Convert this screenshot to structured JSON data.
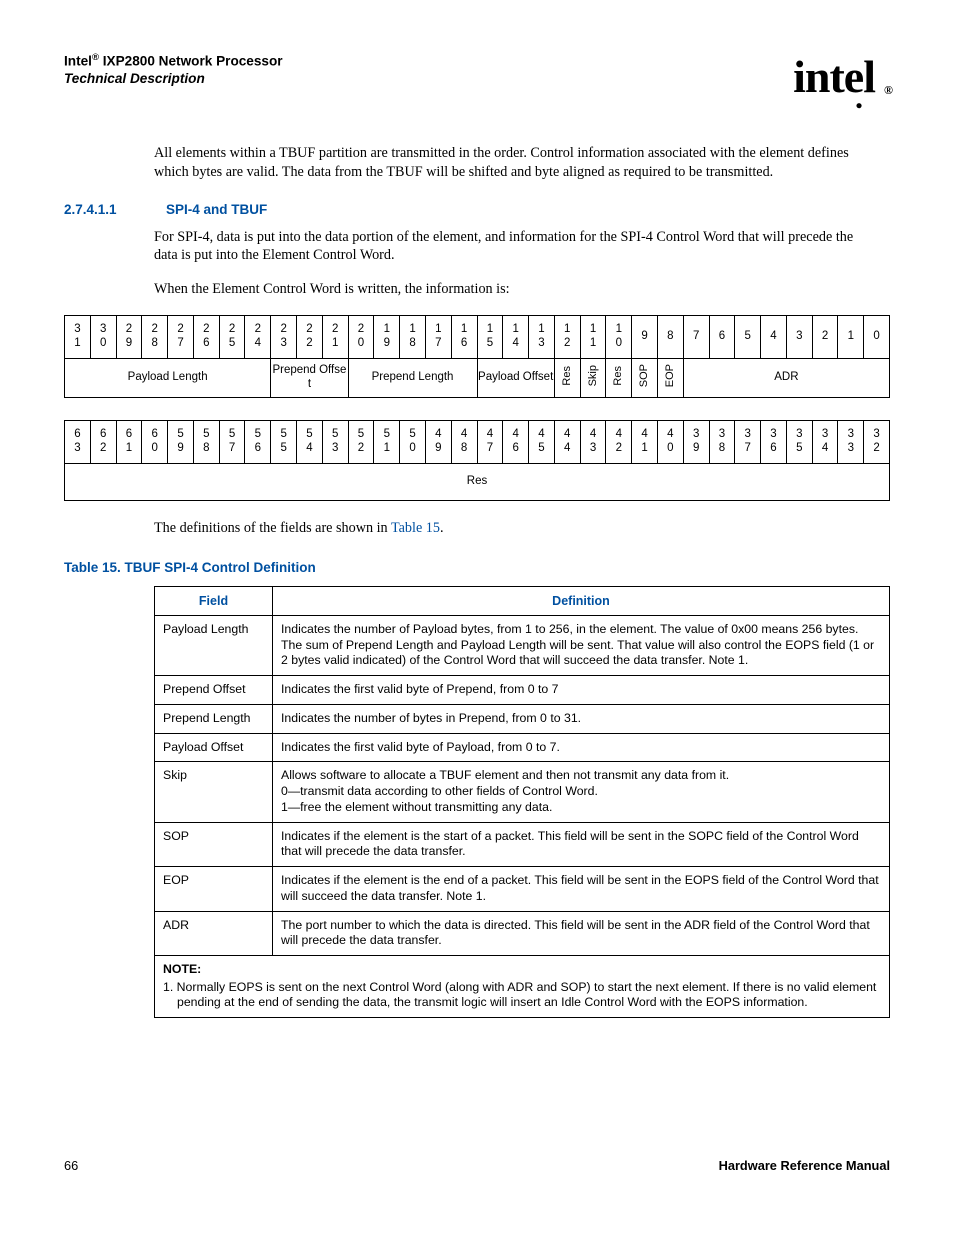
{
  "header": {
    "line1_a": "Intel",
    "line1_sup": "®",
    "line1_b": " IXP2800 Network Processor",
    "line2": "Technical Description",
    "logo_text": "intel",
    "logo_reg": "®"
  },
  "intro_para": "All elements within a TBUF partition are transmitted in the order. Control information associated with the element defines which bytes are valid. The data from the TBUF will be shifted and byte aligned as required to be transmitted.",
  "section": {
    "num": "2.7.4.1.1",
    "title": "SPI-4 and TBUF",
    "p1": "For SPI-4, data is put into the data portion of the element, and information for the SPI-4 Control Word that will precede the data is put into the Element Control Word.",
    "p2": "When the Element Control Word is written, the information is:"
  },
  "bits_t1": {
    "headers": [
      "3\n1",
      "3\n0",
      "2\n9",
      "2\n8",
      "2\n7",
      "2\n6",
      "2\n5",
      "2\n4",
      "2\n3",
      "2\n2",
      "2\n1",
      "2\n0",
      "1\n9",
      "1\n8",
      "1\n7",
      "1\n6",
      "1\n5",
      "1\n4",
      "1\n3",
      "1\n2",
      "1\n1",
      "1\n0",
      "9",
      "8",
      "7",
      "6",
      "5",
      "4",
      "3",
      "2",
      "1",
      "0"
    ],
    "row": [
      {
        "span": 8,
        "label": "Payload Length",
        "vert": false
      },
      {
        "span": 3,
        "label": "Prepend Offset",
        "vert": false
      },
      {
        "span": 5,
        "label": "Prepend Length",
        "vert": false
      },
      {
        "span": 3,
        "label": "Payload Offset",
        "vert": false
      },
      {
        "span": 1,
        "label": "Res",
        "vert": true
      },
      {
        "span": 1,
        "label": "Skip",
        "vert": true
      },
      {
        "span": 1,
        "label": "Res",
        "vert": true
      },
      {
        "span": 1,
        "label": "SOP",
        "vert": true
      },
      {
        "span": 1,
        "label": "EOP",
        "vert": true
      },
      {
        "span": 8,
        "label": "ADR",
        "vert": false
      }
    ]
  },
  "bits_t2": {
    "headers": [
      "6\n3",
      "6\n2",
      "6\n1",
      "6\n0",
      "5\n9",
      "5\n8",
      "5\n7",
      "5\n6",
      "5\n5",
      "5\n4",
      "5\n3",
      "5\n2",
      "5\n1",
      "5\n0",
      "4\n9",
      "4\n8",
      "4\n7",
      "4\n6",
      "4\n5",
      "4\n4",
      "4\n3",
      "4\n2",
      "4\n1",
      "4\n0",
      "3\n9",
      "3\n8",
      "3\n7",
      "3\n6",
      "3\n5",
      "3\n4",
      "3\n3",
      "3\n2"
    ],
    "row": [
      {
        "span": 32,
        "label": "Res",
        "vert": false
      }
    ]
  },
  "after_bits_a": "The definitions of the fields are shown in ",
  "after_bits_xref": "Table 15",
  "after_bits_b": ".",
  "table15": {
    "caption": "Table 15. TBUF SPI-4 Control Definition",
    "head_field": "Field",
    "head_def": "Definition",
    "rows": [
      {
        "f": "Payload Length",
        "d": "Indicates the number of Payload bytes, from 1 to 256, in the element. The value of 0x00 means 256 bytes. The sum of Prepend Length and Payload Length will be sent. That value will also control the EOPS field (1 or 2 bytes valid indicated) of the Control Word that will succeed the data transfer. Note 1."
      },
      {
        "f": "Prepend Offset",
        "d": "Indicates the first valid byte of Prepend, from 0 to 7"
      },
      {
        "f": "Prepend Length",
        "d": "Indicates the number of bytes in Prepend, from 0 to 31."
      },
      {
        "f": "Payload Offset",
        "d": "Indicates the first valid byte of Payload, from 0 to 7."
      },
      {
        "f": "Skip",
        "d": "Allows software to allocate a TBUF element and then not transmit any data from it.\n0—transmit data according to other fields of Control Word.\n1—free the element without transmitting any data."
      },
      {
        "f": "SOP",
        "d": "Indicates if the element is the start of a packet. This field will be sent in the SOPC field of the Control Word that will precede the data transfer."
      },
      {
        "f": "EOP",
        "d": "Indicates if the element is the end of a packet. This field will be sent in the EOPS field of the Control Word that will succeed the data transfer. Note 1."
      },
      {
        "f": "ADR",
        "d": "The port number to which the data is directed. This field will be sent in the ADR field of the Control Word that will precede the data transfer."
      }
    ],
    "note_head": "NOTE:",
    "note_body": "1. Normally EOPS is sent on the next Control Word (along with ADR and SOP) to start the next element. If there is no valid element pending at the end of sending the data, the transmit logic will insert an Idle Control Word with the EOPS information."
  },
  "footer": {
    "page": "66",
    "right": "Hardware Reference Manual"
  }
}
